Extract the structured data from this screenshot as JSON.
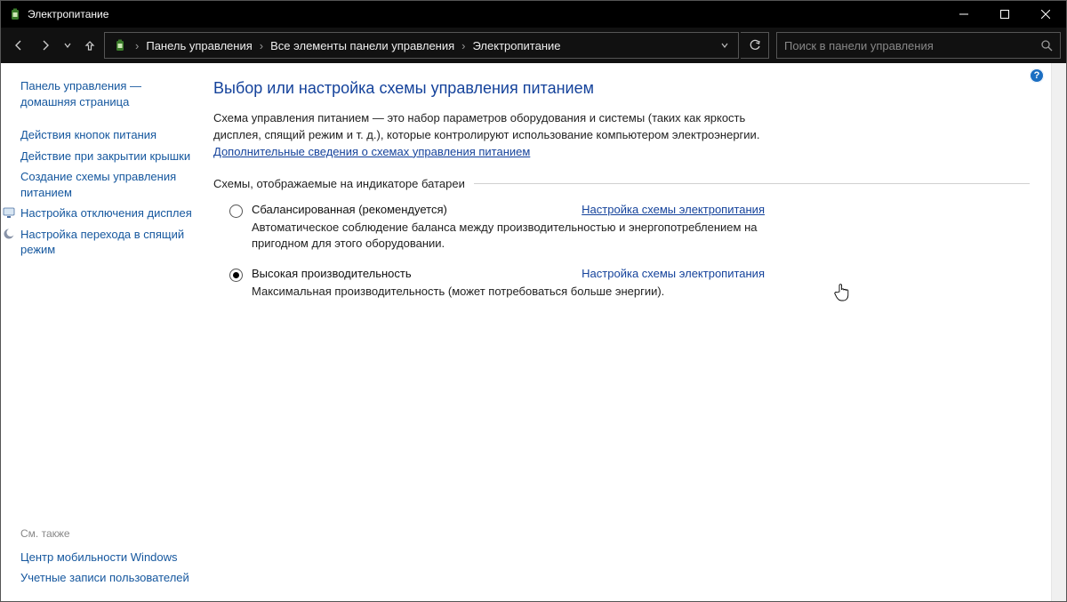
{
  "window": {
    "title": "Электропитание"
  },
  "breadcrumbs": {
    "items": [
      "Панель управления",
      "Все элементы панели управления",
      "Электропитание"
    ]
  },
  "search": {
    "placeholder": "Поиск в панели управления"
  },
  "sidebar": {
    "home": "Панель управления — домашняя страница",
    "links": [
      "Действия кнопок питания",
      "Действие при закрытии крышки",
      "Создание схемы управления питанием"
    ],
    "display_off": "Настройка отключения дисплея",
    "sleep": "Настройка перехода в спящий режим",
    "see_also_header": "См. также",
    "see_also": [
      "Центр мобильности Windows",
      "Учетные записи пользователей"
    ]
  },
  "main": {
    "heading": "Выбор или настройка схемы управления питанием",
    "desc": "Схема управления питанием — это набор параметров оборудования и системы (таких как яркость дисплея, спящий режим и т. д.), которые контролируют использование компьютером электроэнергии.",
    "more_link": "Дополнительные сведения о схемах управления питанием",
    "group_label": "Схемы, отображаемые на индикаторе батареи",
    "plans": [
      {
        "label": "Сбалансированная (рекомендуется)",
        "change": "Настройка схемы электропитания",
        "desc": "Автоматическое соблюдение баланса между производительностью и энергопотреблением на пригодном для этого оборудовании.",
        "selected": false
      },
      {
        "label": "Высокая производительность",
        "change": "Настройка схемы электропитания",
        "desc": "Максимальная производительность (может потребоваться больше энергии).",
        "selected": true
      }
    ]
  }
}
